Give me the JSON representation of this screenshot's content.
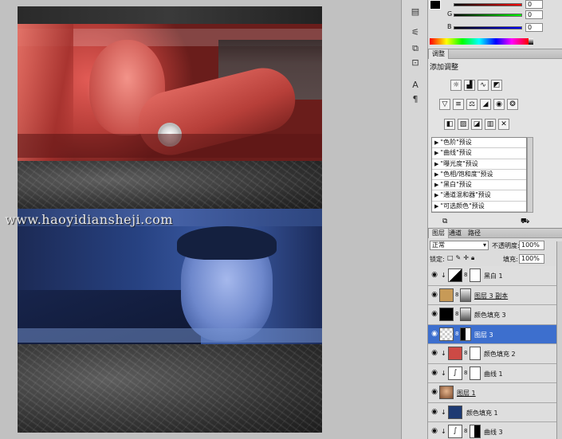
{
  "watermark": "www.haoyidiansheji.com",
  "colors": {
    "selection": "#3d6fce",
    "red_tint": "#c2423c",
    "blue_tint": "#3e5ea8",
    "foreground": "#000000"
  },
  "tools": [
    {
      "icon": "color-panel-icon",
      "glyph": "▤"
    },
    {
      "icon": "sliders-icon",
      "glyph": "⚟"
    },
    {
      "icon": "clone-source-icon",
      "glyph": "⧉"
    },
    {
      "icon": "stamp-icon",
      "glyph": "⊡"
    },
    {
      "icon": "character-icon",
      "glyph": "A"
    },
    {
      "icon": "paragraph-icon",
      "glyph": "¶"
    }
  ],
  "color_panel": {
    "channels": [
      {
        "label": "",
        "value": "0"
      },
      {
        "label": "G",
        "value": "0"
      },
      {
        "label": "B",
        "value": "0"
      }
    ]
  },
  "adjustments": {
    "tab": "调整",
    "title": "添加调整",
    "presets": [
      "\"色阶\"预设",
      "\"曲线\"预设",
      "\"曝光度\"预设",
      "\"色相/饱和度\"预设",
      "\"黑白\"预设",
      "\"通道混和器\"预设",
      "\"可选颜色\"预设"
    ]
  },
  "layers_panel": {
    "tabs": [
      "图层",
      "通道",
      "路径"
    ],
    "blend_mode": "正常",
    "opacity_label": "不透明度:",
    "opacity_value": "100%",
    "lock_label": "锁定:",
    "fill_label": "填充:",
    "fill_value": "100%",
    "layers": [
      {
        "name": "黑白 1",
        "clipped": true,
        "thumb": "adjust-bw",
        "mask": "white",
        "selected": false
      },
      {
        "name": "图层 3 副本",
        "clipped": false,
        "thumb": "tan",
        "mask": "gray",
        "selected": false
      },
      {
        "name": "颜色填充 3",
        "clipped": false,
        "thumb": "black",
        "mask": "gray",
        "selected": false
      },
      {
        "name": "图层 3",
        "clipped": false,
        "thumb": "checker",
        "mask": "black-white",
        "selected": true
      },
      {
        "name": "颜色填充 2",
        "clipped": true,
        "thumb": "red",
        "mask": "white",
        "selected": false
      },
      {
        "name": "曲线 1",
        "clipped": true,
        "thumb": "curves",
        "mask": "white",
        "selected": false
      },
      {
        "name": "图层 1",
        "clipped": false,
        "thumb": "photo",
        "mask": "",
        "selected": false
      },
      {
        "name": "颜色填充 1",
        "clipped": true,
        "thumb": "navy",
        "mask": "",
        "selected": false
      },
      {
        "name": "曲线 3",
        "clipped": true,
        "thumb": "curves",
        "mask": "white-black",
        "selected": false
      }
    ]
  }
}
